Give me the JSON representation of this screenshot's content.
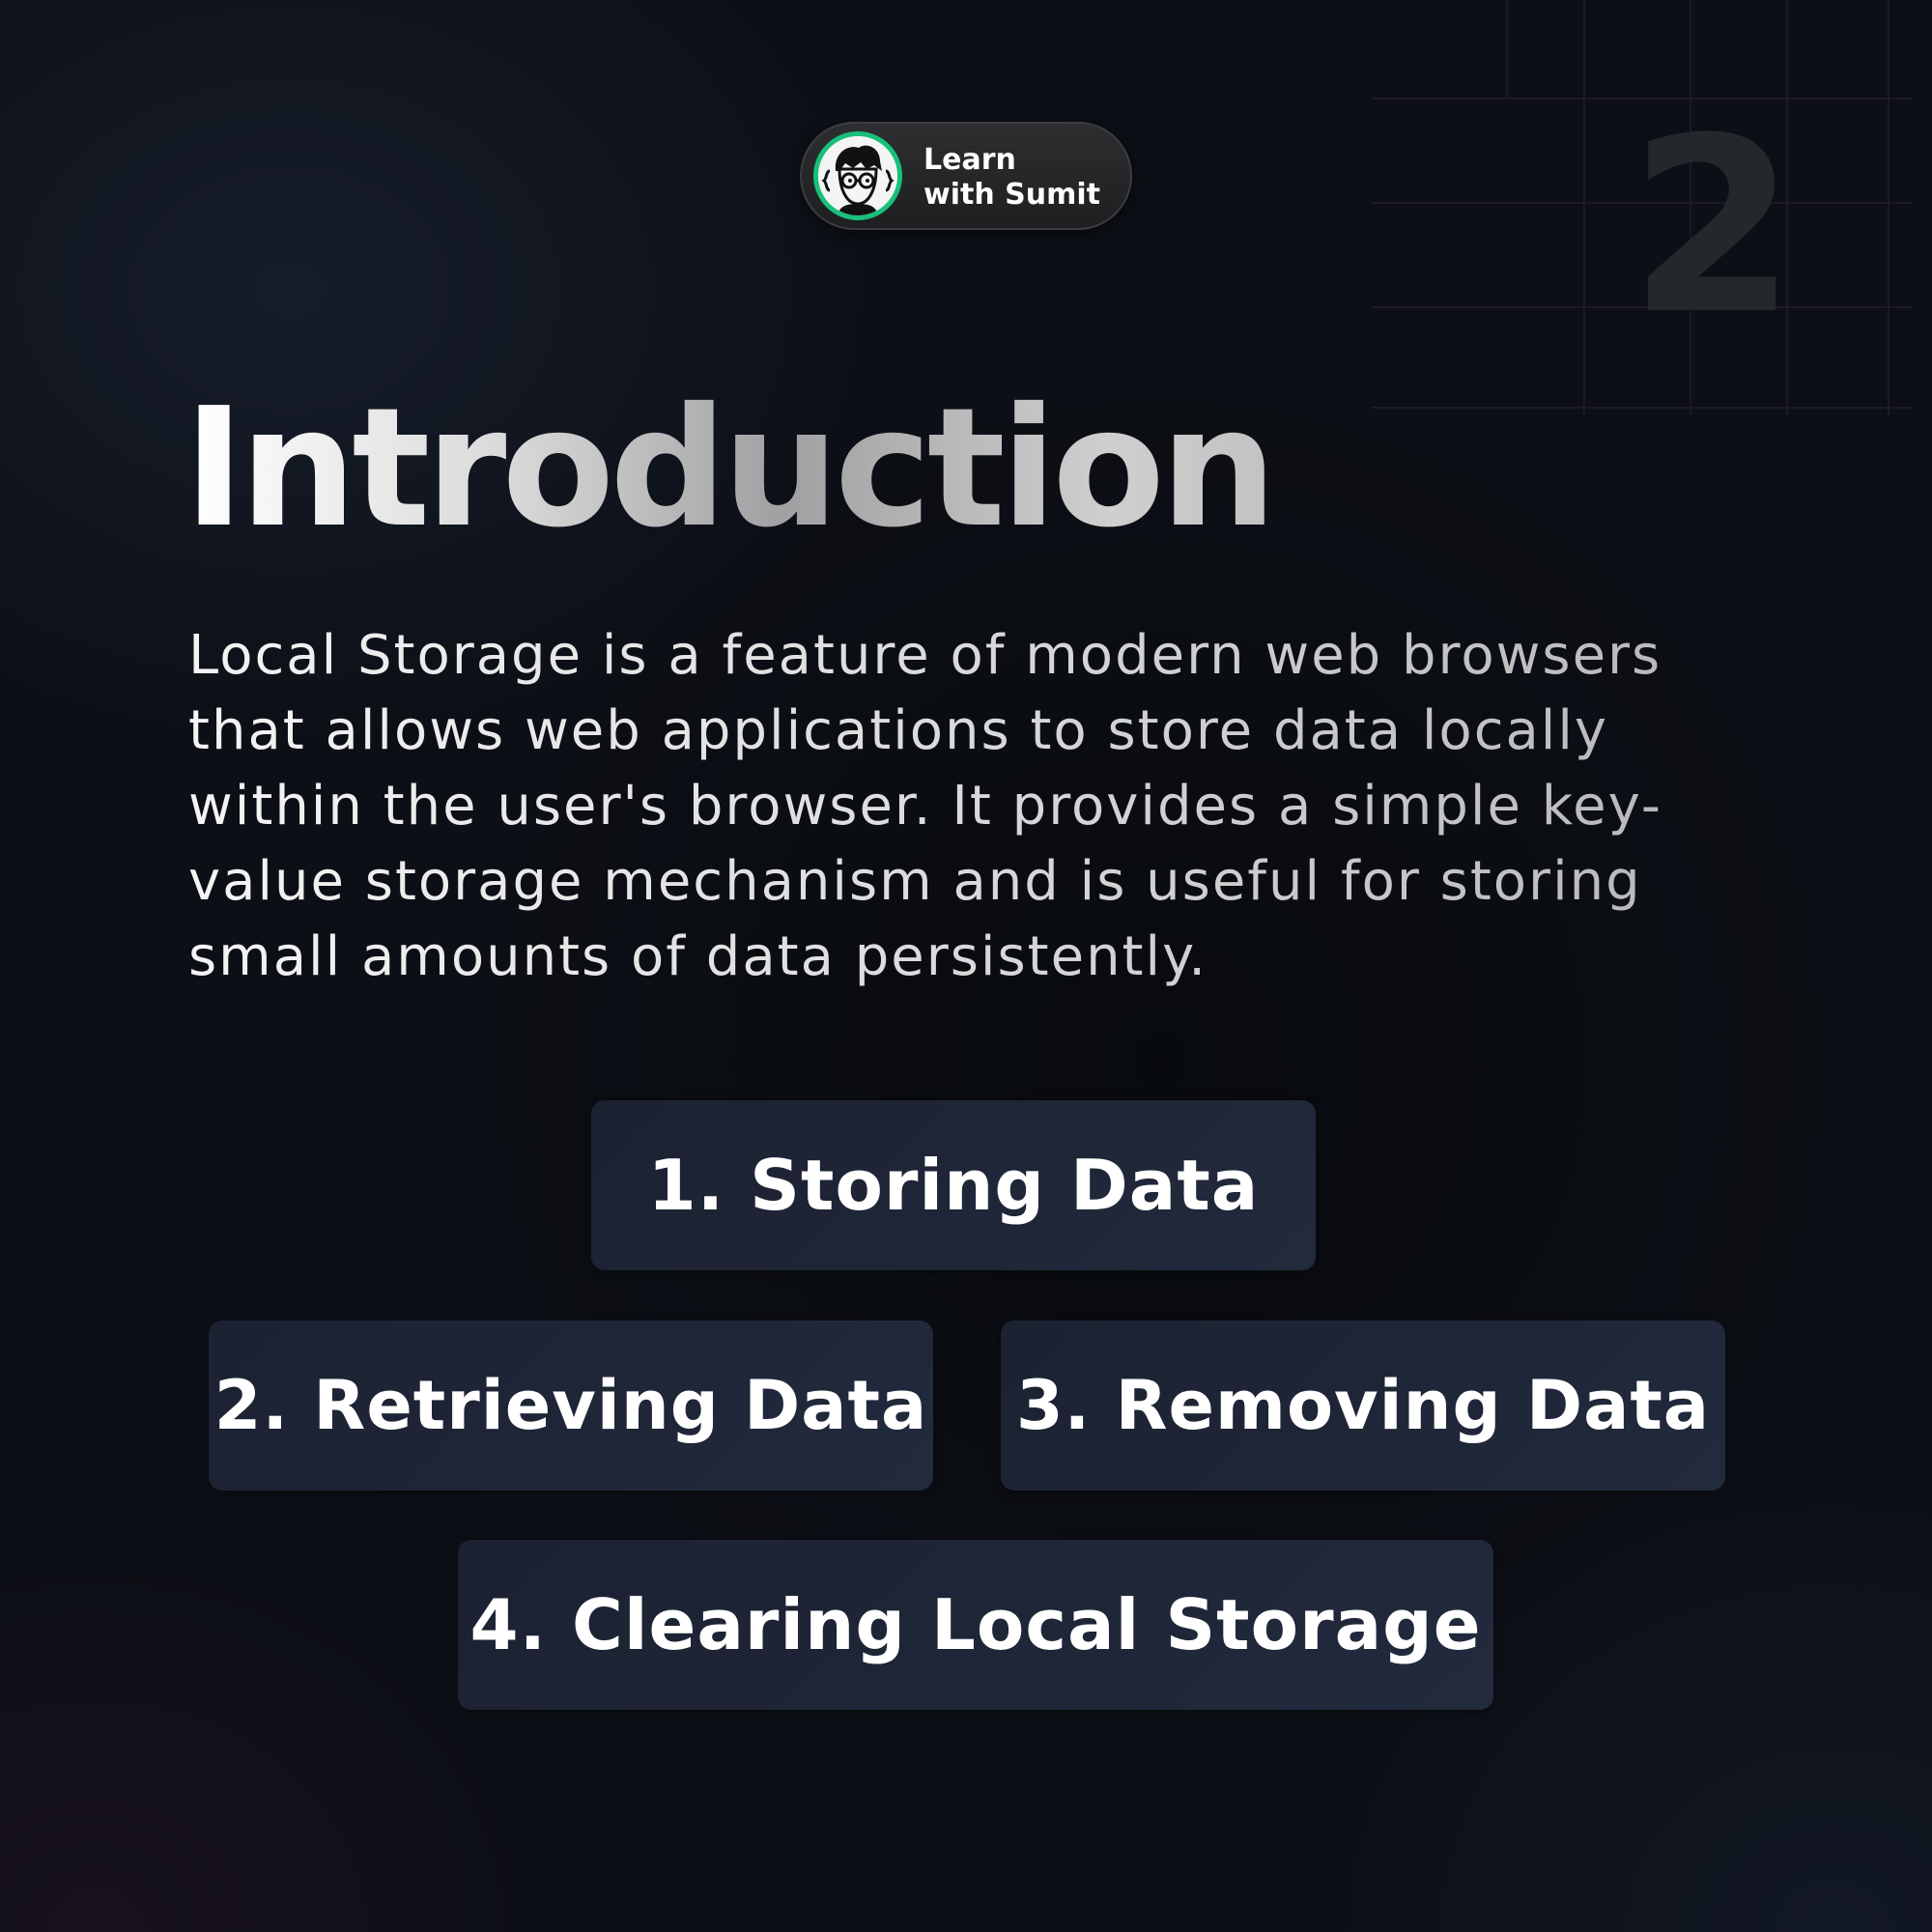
{
  "brand": {
    "line1": "Learn",
    "line2": "with Sumit",
    "avatar_icon": "coder-avatar-icon",
    "ring_color": "#18c07a"
  },
  "page_number": "2",
  "title": "Introduction",
  "description": "Local Storage is a feature of modern web browsers\nthat allows web applications to store data locally\nwithin the user's browser. It provides a simple key-\nvalue storage mechanism and is useful for storing\nsmall amounts of data persistently.",
  "topics": [
    "1. Storing Data",
    "2. Retrieving Data",
    "3. Removing Data",
    "4. Clearing Local Storage"
  ],
  "colors": {
    "background": "#0c0f15",
    "card": "#1f2638",
    "accent": "#18c07a"
  }
}
